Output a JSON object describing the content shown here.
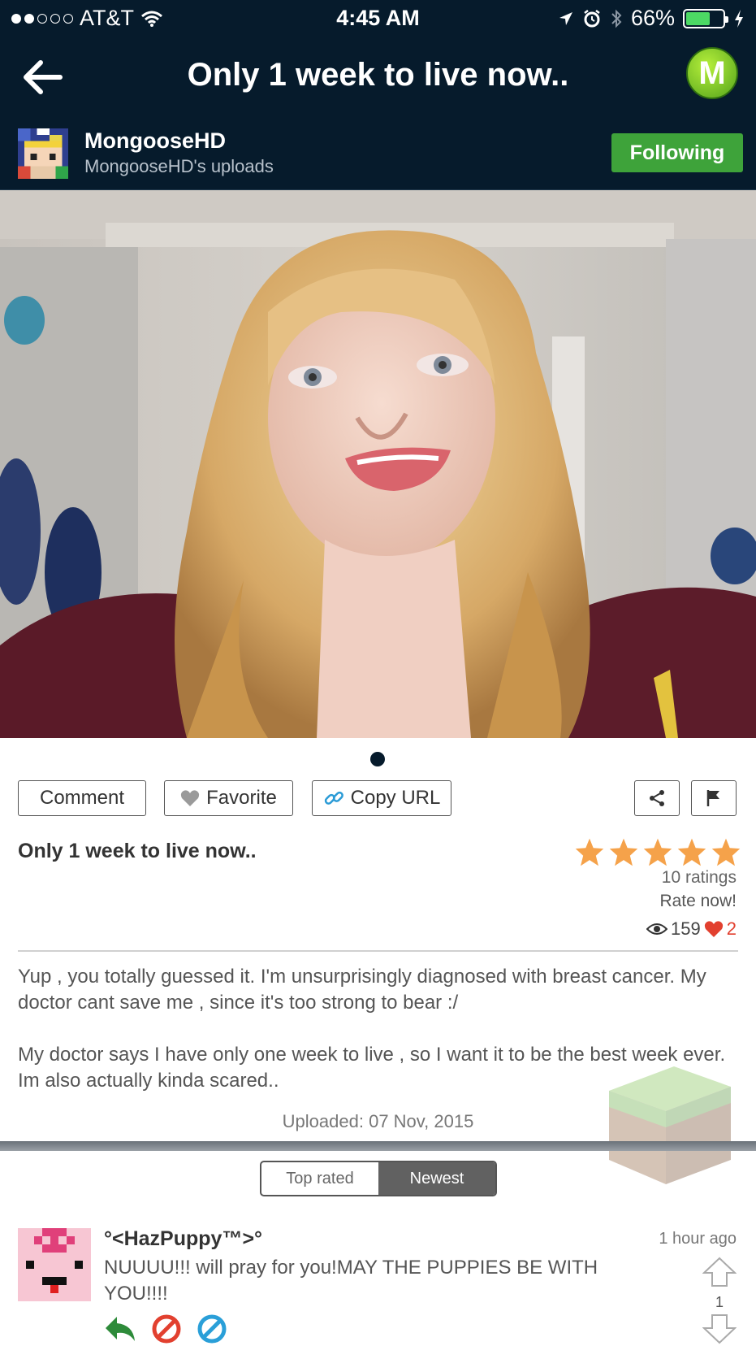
{
  "status_bar": {
    "carrier": "AT&T",
    "time": "4:45 AM",
    "battery_percent": "66%",
    "battery_level": 0.66,
    "signal_bars_filled": 2
  },
  "nav": {
    "title": "Only 1 week to live now..",
    "logo_letter": "M"
  },
  "uploader": {
    "name": "MongooseHD",
    "subtitle": "MongooseHD's uploads",
    "follow_label": "Following"
  },
  "actions": {
    "comment": "Comment",
    "favorite": "Favorite",
    "copy_url": "Copy URL"
  },
  "post": {
    "title": "Only 1 week to live now..",
    "rating_stars": 5,
    "ratings_count": "10 ratings",
    "rate_now": "Rate now!",
    "views": "159",
    "likes": "2",
    "description": [
      "Yup , you totally guessed it. I'm unsurprisingly diagnosed with breast cancer. My doctor cant save me , since it's too strong to bear :/",
      "My doctor says I have only one week to live , so I want it to be the best week ever. Im also actually kinda scared.."
    ],
    "uploaded": "Uploaded: 07 Nov, 2015"
  },
  "sort_tabs": {
    "top_rated": "Top rated",
    "newest": "Newest",
    "active": "newest"
  },
  "comments": [
    {
      "author": "°<HazPuppy™>°",
      "time": "1 hour ago",
      "text": "NUUUU!!! will pray for you!MAY THE PUPPIES BE WITH YOU!!!!",
      "votes": "1"
    }
  ],
  "colors": {
    "header_bg": "#061b2c",
    "follow_green": "#3ea33a",
    "star_orange": "#f5a24a",
    "heart_red": "#e2402f"
  }
}
